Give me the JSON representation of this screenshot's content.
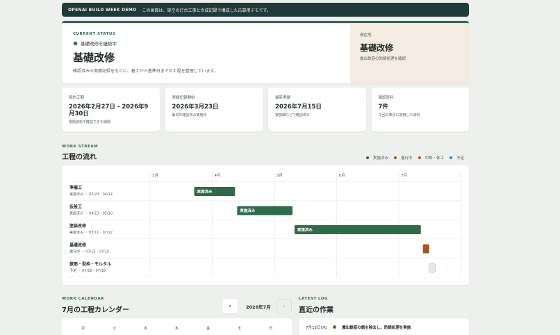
{
  "banner": {
    "tag": "OPENAI BUILD WEEK DEMO",
    "text": "この画面は、架空の灯台工事と合成記録で構成した応募用デモです。"
  },
  "status": {
    "eyebrow": "CURRENT STATUS",
    "state": "基礎改修を継続中",
    "title": "基礎改修",
    "description": "確認済みの実績記録をもとに、着工から基準日までの工程を整理しています。",
    "location_label": "現在地",
    "location_title": "基礎改修",
    "location_desc": "露出鉄筋の防錆処理を確認"
  },
  "cards": [
    {
      "key": "契約工期",
      "value": "2026年2月27日 - 2026年9月30日",
      "sub": "根拠資料で確認できた期間"
    },
    {
      "key": "実績記録開始",
      "value": "2026年3月23日",
      "sub": "最初の確認済み実施日"
    },
    {
      "key": "最新実績",
      "value": "2026年7月15日",
      "sub": "実施欄などで確認済み"
    },
    {
      "key": "確認資料",
      "value": "7件",
      "sub": "今回の表示に使用した資料"
    }
  ],
  "workstream": {
    "eyebrow": "WORK STREAM",
    "title": "工程の流れ",
    "legend": [
      {
        "label": "実施済み",
        "color": "#2e6b4b"
      },
      {
        "label": "進行中",
        "color": "#a9541f"
      },
      {
        "label": "中断・休工",
        "color": "#c1483a"
      },
      {
        "label": "予定",
        "color": "#3f7fb0"
      }
    ]
  },
  "chart_data": {
    "type": "gantt",
    "months": [
      "3月",
      "4月",
      "5月",
      "6月",
      "7月"
    ],
    "tasks": [
      {
        "name": "準備工",
        "status": "実施済み",
        "range": "03/23 - 04/12",
        "start": "2026-03-23",
        "end": "2026-04-12",
        "bar_label": "実施済み",
        "state": "done"
      },
      {
        "name": "仮設工",
        "status": "実施済み",
        "range": "04/13 - 05/10",
        "start": "2026-04-13",
        "end": "2026-05-10",
        "bar_label": "実施済み",
        "state": "done"
      },
      {
        "name": "塗装改修",
        "status": "実施済み",
        "range": "05/11 - 07/12",
        "start": "2026-05-11",
        "end": "2026-07-12",
        "bar_label": "実施済み",
        "state": "done"
      },
      {
        "name": "基礎改修",
        "status": "進行中",
        "range": "07/13 - 07/15",
        "start": "2026-07-13",
        "end": "2026-07-15",
        "bar_label": "",
        "state": "progress"
      },
      {
        "name": "鉄筋・型枠・モルタル",
        "status": "予定",
        "range": "07/16 - 07/18",
        "start": "2026-07-16",
        "end": "2026-07-18",
        "bar_label": "",
        "state": "planned"
      }
    ]
  },
  "calendar": {
    "eyebrow": "WORK CALENDAR",
    "title": "7月の工程カレンダー",
    "month": "2026年7月",
    "prev": "‹",
    "next": "›",
    "weekdays": [
      "月",
      "火",
      "水",
      "木",
      "金",
      "土",
      "日"
    ]
  },
  "log": {
    "eyebrow": "LATEST LOG",
    "title": "直近の作業",
    "entries": [
      {
        "date": "7月15日(水)",
        "text": "露出鉄筋の錆を除去し、防錆処理を実施"
      }
    ]
  }
}
